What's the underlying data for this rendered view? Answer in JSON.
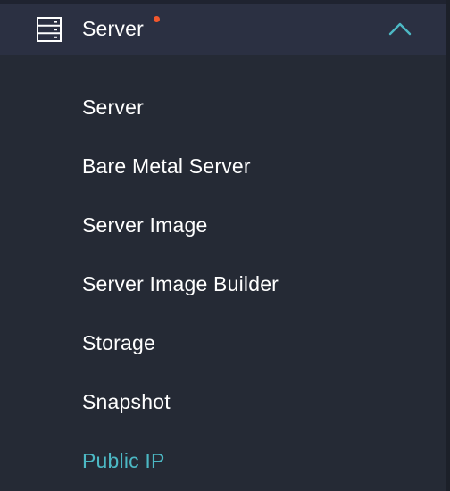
{
  "section": {
    "label": "Server",
    "icon": "server-rack-icon",
    "expanded": true,
    "has_notification": true,
    "notification_color": "#f2572d"
  },
  "submenu": [
    {
      "label": "Server"
    },
    {
      "label": "Bare Metal Server"
    },
    {
      "label": "Server Image"
    },
    {
      "label": "Server Image Builder"
    },
    {
      "label": "Storage"
    },
    {
      "label": "Snapshot"
    },
    {
      "label": "Public IP",
      "active": true
    }
  ],
  "colors": {
    "background": "#252a35",
    "header_background": "#2b3042",
    "text": "#ffffff",
    "accent": "#4cb8c4",
    "notification": "#f2572d"
  }
}
